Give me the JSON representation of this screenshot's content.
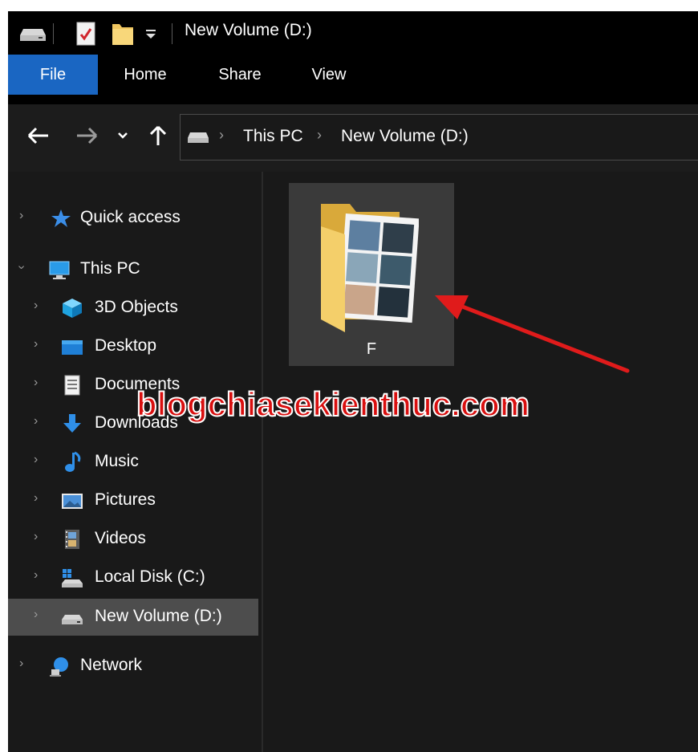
{
  "window": {
    "title": "New Volume (D:)"
  },
  "ribbon": {
    "tabs": [
      {
        "label": "File"
      },
      {
        "label": "Home"
      },
      {
        "label": "Share"
      },
      {
        "label": "View"
      }
    ],
    "active_tab_color": "#1a66c2"
  },
  "navigation": {
    "back_icon": "arrow-left-icon",
    "forward_icon": "arrow-right-icon",
    "recent_icon": "chevron-down-icon",
    "up_icon": "arrow-up-icon"
  },
  "address_bar": {
    "crumbs": [
      "This PC",
      "New Volume (D:)"
    ]
  },
  "sidebar": {
    "items": [
      {
        "label": "Quick access",
        "icon": "star-icon"
      },
      {
        "label": "This PC",
        "icon": "computer-icon"
      },
      {
        "label": "3D Objects",
        "icon": "cube-icon"
      },
      {
        "label": "Desktop",
        "icon": "desktop-icon"
      },
      {
        "label": "Documents",
        "icon": "document-icon"
      },
      {
        "label": "Downloads",
        "icon": "download-icon"
      },
      {
        "label": "Music",
        "icon": "music-note-icon"
      },
      {
        "label": "Pictures",
        "icon": "picture-icon"
      },
      {
        "label": "Videos",
        "icon": "film-icon"
      },
      {
        "label": "Local Disk (C:)",
        "icon": "windows-drive-icon"
      },
      {
        "label": "New Volume (D:)",
        "icon": "drive-icon",
        "selected": true
      },
      {
        "label": "Network",
        "icon": "network-icon"
      }
    ]
  },
  "content": {
    "items": [
      {
        "name": "F",
        "icon": "folder-with-images-icon"
      }
    ]
  },
  "overlay": {
    "watermark": "blogchiasekienthuc.com",
    "accent": "#d90f0f"
  }
}
